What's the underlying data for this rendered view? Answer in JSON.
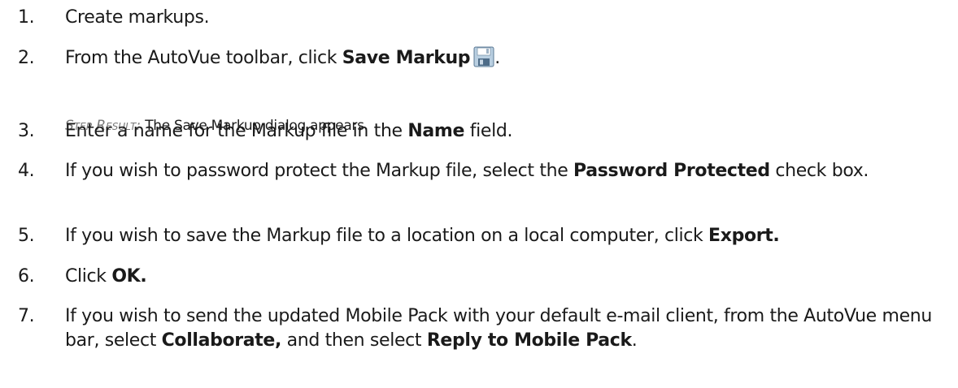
{
  "steps": [
    {
      "number": "1.",
      "text": "Create markups."
    },
    {
      "number": "2.",
      "pre": "From the AutoVue toolbar, click ",
      "bold": "Save Markup",
      "icon": "save-markup-icon",
      "post": "."
    },
    {
      "number": "3.",
      "pre": "Enter a name for the Markup file in the ",
      "bold": "Name",
      "post": " field."
    },
    {
      "number": "4.",
      "pre": "If you wish to password protect the Markup file, select the ",
      "bold": "Password Protected",
      "post": " check box."
    },
    {
      "number": "5.",
      "pre": "If you wish to save the Markup file to a location on a local computer, click ",
      "bold": "Export."
    },
    {
      "number": "6.",
      "pre": "Click ",
      "bold": "OK."
    },
    {
      "number": "7.",
      "pre": "If you wish to send the updated Mobile Pack with your default e-mail client, from the AutoVue menu bar, select ",
      "bold": "Collaborate,",
      "mid": " and then select ",
      "bold2": "Reply to Mobile Pack",
      "post": "."
    }
  ],
  "step_result": {
    "label": "Step Result:",
    "text": "The Save Markup dialog appears."
  }
}
